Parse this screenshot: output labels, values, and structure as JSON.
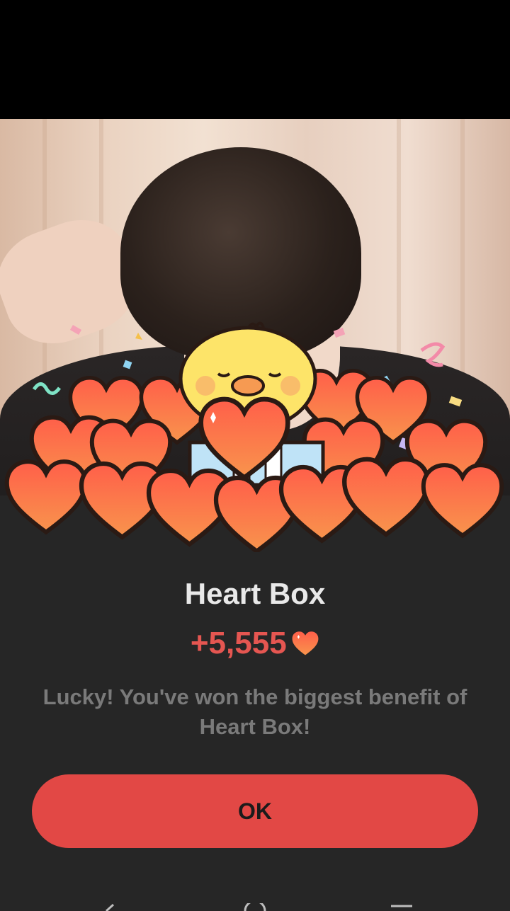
{
  "dialog": {
    "title": "Heart Box",
    "amount": "+5,555",
    "message": "Lucky! You've won the biggest benefit of Heart Box!",
    "ok_label": "OK"
  },
  "colors": {
    "accent": "#e24845",
    "amount": "#e55651",
    "sheet_bg": "#262626",
    "heart_fill": "#f4674f"
  },
  "icons": [
    "heart-icon",
    "back-icon",
    "home-icon",
    "recents-icon"
  ]
}
